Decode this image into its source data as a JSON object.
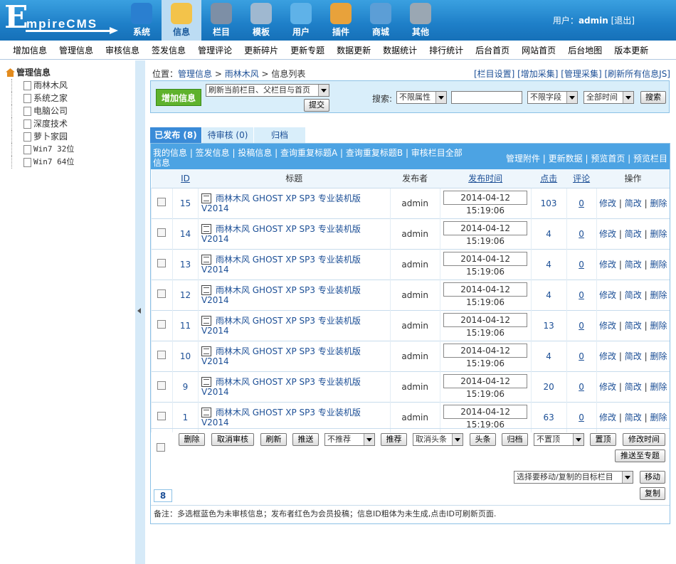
{
  "app": {
    "logo_e": "E",
    "logo_rest": "mpireCMS"
  },
  "topnav": [
    {
      "label": "系统",
      "icon": "globe-icon",
      "color": "#2a7fd0",
      "active": false
    },
    {
      "label": "信息",
      "icon": "notepad-icon",
      "color": "#f3c34a",
      "active": true
    },
    {
      "label": "栏目",
      "icon": "folder-icon",
      "color": "#7d8fa6",
      "active": false
    },
    {
      "label": "模板",
      "icon": "window-icon",
      "color": "#9fb8d0",
      "active": false
    },
    {
      "label": "用户",
      "icon": "user-icon",
      "color": "#5fb2e8",
      "active": false
    },
    {
      "label": "插件",
      "icon": "tools-icon",
      "color": "#e8a23b",
      "active": false
    },
    {
      "label": "商城",
      "icon": "card-icon",
      "color": "#5c9ed6",
      "active": false
    },
    {
      "label": "其他",
      "icon": "gear-icon",
      "color": "#9aa7b3",
      "active": false
    }
  ],
  "user": {
    "prefix": "用户：",
    "name": "admin",
    "logout": "[退出]"
  },
  "menubar": [
    "增加信息",
    "管理信息",
    "审核信息",
    "签发信息",
    "管理评论",
    "更新碎片",
    "更新专题",
    "数据更新",
    "数据统计",
    "排行统计",
    "后台首页",
    "网站首页",
    "后台地图",
    "版本更新"
  ],
  "sidebar": {
    "root": "管理信息",
    "items": [
      "雨林木风",
      "系统之家",
      "电脑公司",
      "深度技术",
      "萝卜家园",
      "Win7 32位",
      "Win7 64位"
    ]
  },
  "breadcrumb": {
    "prefix": "位置：",
    "l1": "管理信息",
    "sep": " > ",
    "l2": "雨林木风",
    "l3": "信息列表"
  },
  "toplinks": "[栏目设置] [增加采集] [管理采集] [刷新所有信息JS]",
  "search": {
    "add_label": "增加信息",
    "refresh_select": "刷新当前栏目、父栏目与首页",
    "submit": "提交",
    "search_label": "搜索:",
    "attr_select": "不限属性",
    "field_select": "不限字段",
    "time_select": "全部时间",
    "search_btn": "搜索",
    "keyword": ""
  },
  "tabs": [
    {
      "label": "已发布 (8)"
    },
    {
      "label": "待审核 (0)"
    },
    {
      "label": "归档"
    }
  ],
  "linkbar": {
    "left": "我的信息 | 签发信息 | 投稿信息 | 查询重复标题A | 查询重复标题B | 审核栏目全部信息",
    "right": "管理附件 | 更新数据 | 预览首页 | 预览栏目"
  },
  "columns": {
    "id": "ID",
    "title": "标题",
    "author": "发布者",
    "time": "发布时间",
    "hits": "点击",
    "comments": "评论",
    "ops": "操作"
  },
  "rows": [
    {
      "id": "15",
      "title": "雨林木风 GHOST XP SP3 专业装机版 V2014",
      "author": "admin",
      "time": "2014-04-12 15:19:06",
      "hits": "103",
      "comments": "0"
    },
    {
      "id": "14",
      "title": "雨林木风 GHOST XP SP3 专业装机版 V2014",
      "author": "admin",
      "time": "2014-04-12 15:19:06",
      "hits": "4",
      "comments": "0"
    },
    {
      "id": "13",
      "title": "雨林木风 GHOST XP SP3 专业装机版 V2014",
      "author": "admin",
      "time": "2014-04-12 15:19:06",
      "hits": "4",
      "comments": "0"
    },
    {
      "id": "12",
      "title": "雨林木风 GHOST XP SP3 专业装机版 V2014",
      "author": "admin",
      "time": "2014-04-12 15:19:06",
      "hits": "4",
      "comments": "0"
    },
    {
      "id": "11",
      "title": "雨林木风 GHOST XP SP3 专业装机版 V2014",
      "author": "admin",
      "time": "2014-04-12 15:19:06",
      "hits": "13",
      "comments": "0"
    },
    {
      "id": "10",
      "title": "雨林木风 GHOST XP SP3 专业装机版 V2014",
      "author": "admin",
      "time": "2014-04-12 15:19:06",
      "hits": "4",
      "comments": "0"
    },
    {
      "id": "9",
      "title": "雨林木风 GHOST XP SP3 专业装机版 V2014",
      "author": "admin",
      "time": "2014-04-12 15:19:06",
      "hits": "20",
      "comments": "0"
    },
    {
      "id": "1",
      "title": "雨林木风 GHOST XP SP3 专业装机版 V2014",
      "author": "admin",
      "time": "2014-04-12 15:19:06",
      "hits": "63",
      "comments": "0"
    }
  ],
  "ops": {
    "edit": "修改",
    "quick": "简改",
    "del": "删除",
    "sep": " | "
  },
  "bulk": {
    "delete": "删除",
    "unaudit": "取消审核",
    "refresh": "刷新",
    "push": "推送",
    "recommend_select": "不推荐",
    "recommend": "推荐",
    "headline_select": "取消头条",
    "headline": "头条",
    "archive": "归档",
    "top_select": "不置顶",
    "top": "置顶",
    "edit_time": "修改时间",
    "push_topic": "推送至专题",
    "target_select": "选择要移动/复制的目标栏目",
    "move": "移动",
    "copy": "复制"
  },
  "page": "8",
  "note": "备注：多选框蓝色为未审核信息；发布者红色为会员投稿；信息ID粗体为未生成,点击ID可刷新页面."
}
